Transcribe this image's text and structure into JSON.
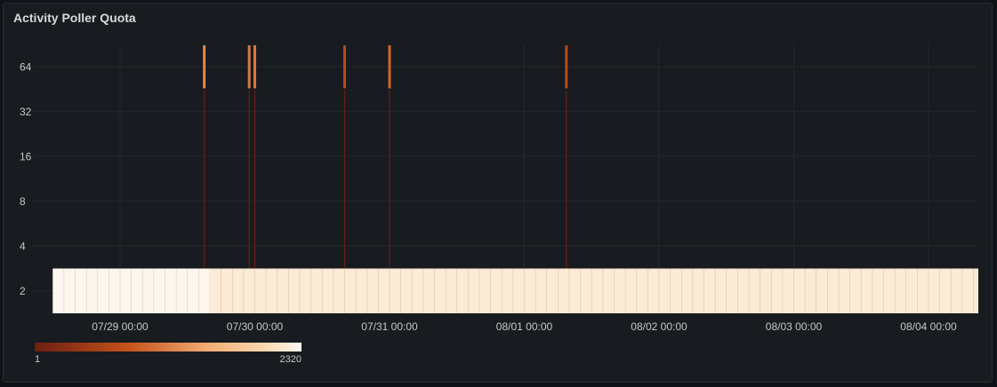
{
  "panel": {
    "title": "Activity Poller Quota"
  },
  "chart_data": {
    "type": "heatmap",
    "title": "Activity Poller Quota",
    "x_start": "07/28 12:00",
    "x_end": "08/04 13:00",
    "x_ticks": [
      "07/29 00:00",
      "07/30 00:00",
      "07/31 00:00",
      "08/01 00:00",
      "08/02 00:00",
      "08/03 00:00",
      "08/04 00:00"
    ],
    "y_ticks": [
      "2",
      "4",
      "8",
      "16",
      "32",
      "64"
    ],
    "y_scale": "log2",
    "grid": true,
    "color_scale": {
      "min": 1,
      "max": 2320,
      "min_label": "1",
      "max_label": "2320",
      "scheme": "oranges"
    },
    "buckets": [
      {
        "y": 2,
        "from": "07/28 12:00",
        "to": "07/29 16:00",
        "count": 2320
      },
      {
        "y": 2,
        "from": "07/29 16:00",
        "to": "08/04 13:00",
        "count": 1500
      }
    ],
    "spikes": [
      {
        "time": "07/29 15:00",
        "count": 60
      },
      {
        "time": "07/29 23:00",
        "count": 40
      },
      {
        "time": "07/30 00:00",
        "count": 40
      },
      {
        "time": "07/30 16:00",
        "count": 10
      },
      {
        "time": "07/31 00:00",
        "count": 25
      },
      {
        "time": "08/01 07:30",
        "count": 10
      }
    ]
  }
}
